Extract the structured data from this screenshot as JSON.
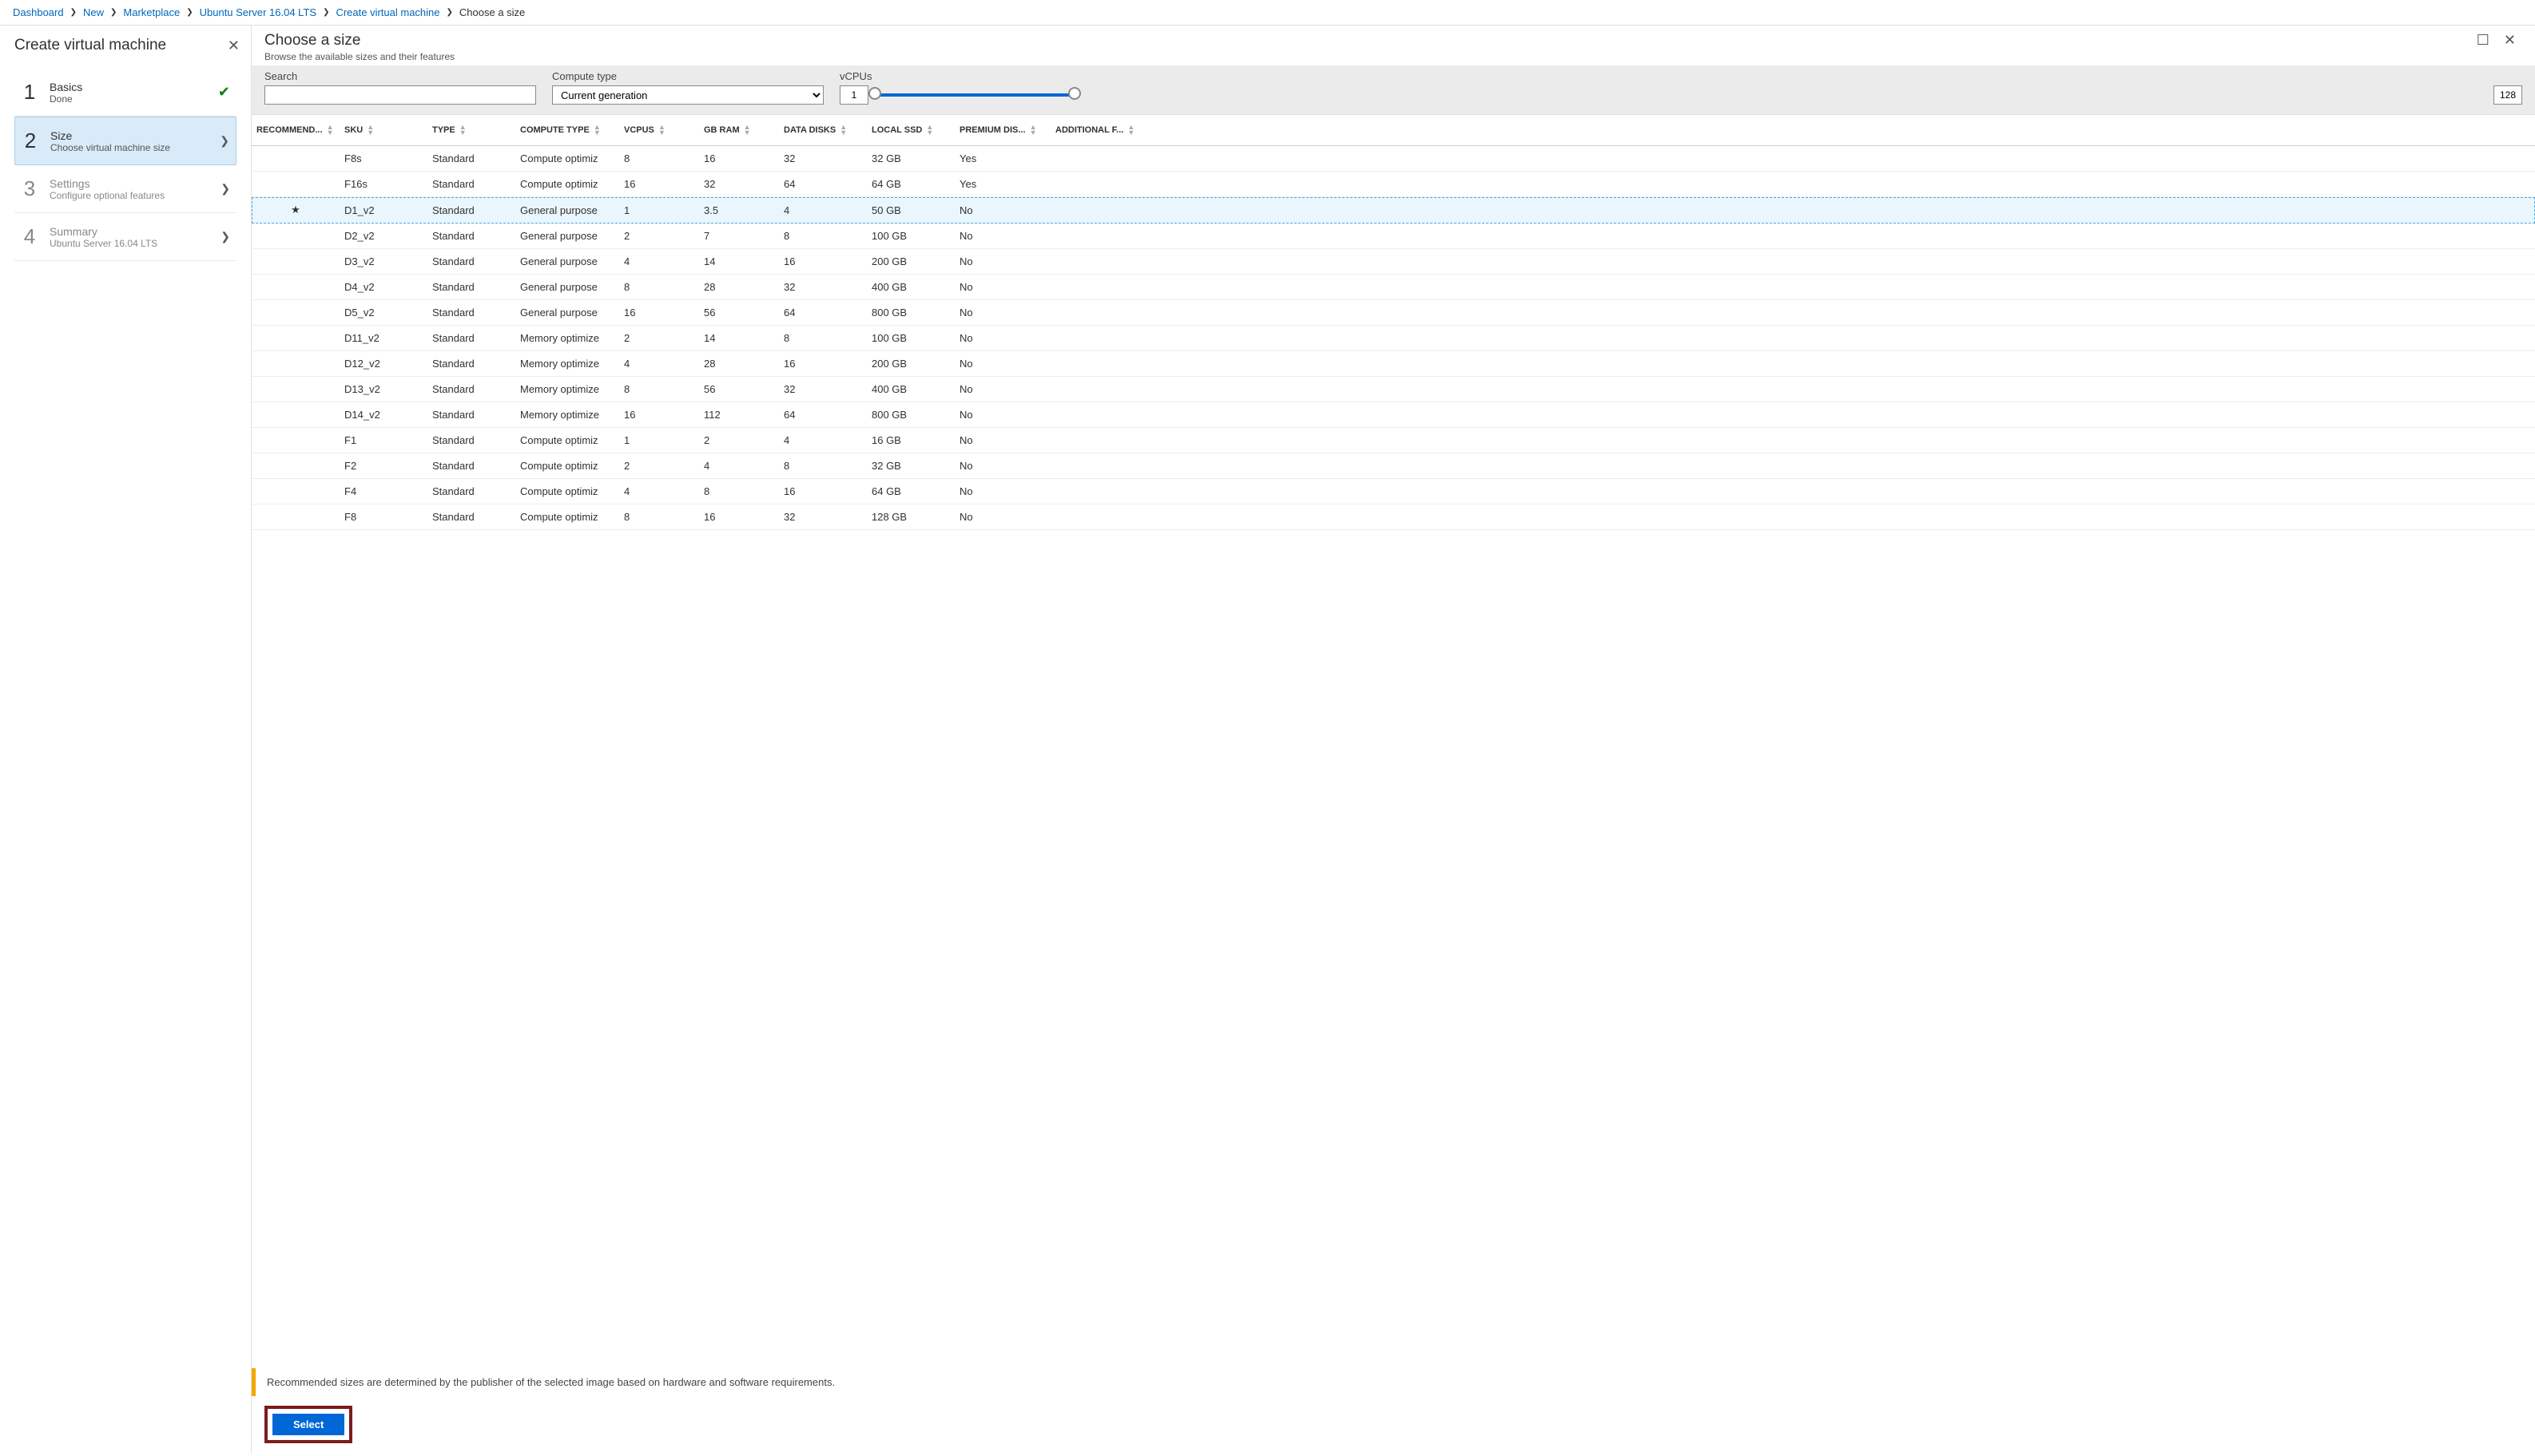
{
  "breadcrumb": {
    "items": [
      "Dashboard",
      "New",
      "Marketplace",
      "Ubuntu Server 16.04 LTS",
      "Create virtual machine"
    ],
    "current": "Choose a size"
  },
  "leftPanel": {
    "title": "Create virtual machine",
    "steps": [
      {
        "num": "1",
        "label": "Basics",
        "sub": "Done"
      },
      {
        "num": "2",
        "label": "Size",
        "sub": "Choose virtual machine size"
      },
      {
        "num": "3",
        "label": "Settings",
        "sub": "Configure optional features"
      },
      {
        "num": "4",
        "label": "Summary",
        "sub": "Ubuntu Server 16.04 LTS"
      }
    ]
  },
  "rightPanel": {
    "title": "Choose a size",
    "subtitle": "Browse the available sizes and their features"
  },
  "filters": {
    "searchLabel": "Search",
    "searchValue": "",
    "computeLabel": "Compute type",
    "computeValue": "Current generation",
    "vcpuLabel": "vCPUs",
    "vcpuMin": "1",
    "vcpuMax": "128"
  },
  "columns": [
    "RECOMMEND...",
    "SKU",
    "TYPE",
    "COMPUTE TYPE",
    "VCPUS",
    "GB RAM",
    "DATA DISKS",
    "LOCAL SSD",
    "PREMIUM DIS...",
    "ADDITIONAL F..."
  ],
  "rows": [
    {
      "rec": "",
      "sku": "F8s",
      "type": "Standard",
      "ctype": "Compute optimiz",
      "vcpus": "8",
      "ram": "16",
      "disks": "32",
      "ssd": "32 GB",
      "prem": "Yes",
      "add": ""
    },
    {
      "rec": "",
      "sku": "F16s",
      "type": "Standard",
      "ctype": "Compute optimiz",
      "vcpus": "16",
      "ram": "32",
      "disks": "64",
      "ssd": "64 GB",
      "prem": "Yes",
      "add": ""
    },
    {
      "rec": "★",
      "sku": "D1_v2",
      "type": "Standard",
      "ctype": "General purpose",
      "vcpus": "1",
      "ram": "3.5",
      "disks": "4",
      "ssd": "50 GB",
      "prem": "No",
      "add": "",
      "selected": true
    },
    {
      "rec": "",
      "sku": "D2_v2",
      "type": "Standard",
      "ctype": "General purpose",
      "vcpus": "2",
      "ram": "7",
      "disks": "8",
      "ssd": "100 GB",
      "prem": "No",
      "add": ""
    },
    {
      "rec": "",
      "sku": "D3_v2",
      "type": "Standard",
      "ctype": "General purpose",
      "vcpus": "4",
      "ram": "14",
      "disks": "16",
      "ssd": "200 GB",
      "prem": "No",
      "add": ""
    },
    {
      "rec": "",
      "sku": "D4_v2",
      "type": "Standard",
      "ctype": "General purpose",
      "vcpus": "8",
      "ram": "28",
      "disks": "32",
      "ssd": "400 GB",
      "prem": "No",
      "add": ""
    },
    {
      "rec": "",
      "sku": "D5_v2",
      "type": "Standard",
      "ctype": "General purpose",
      "vcpus": "16",
      "ram": "56",
      "disks": "64",
      "ssd": "800 GB",
      "prem": "No",
      "add": ""
    },
    {
      "rec": "",
      "sku": "D11_v2",
      "type": "Standard",
      "ctype": "Memory optimize",
      "vcpus": "2",
      "ram": "14",
      "disks": "8",
      "ssd": "100 GB",
      "prem": "No",
      "add": ""
    },
    {
      "rec": "",
      "sku": "D12_v2",
      "type": "Standard",
      "ctype": "Memory optimize",
      "vcpus": "4",
      "ram": "28",
      "disks": "16",
      "ssd": "200 GB",
      "prem": "No",
      "add": ""
    },
    {
      "rec": "",
      "sku": "D13_v2",
      "type": "Standard",
      "ctype": "Memory optimize",
      "vcpus": "8",
      "ram": "56",
      "disks": "32",
      "ssd": "400 GB",
      "prem": "No",
      "add": ""
    },
    {
      "rec": "",
      "sku": "D14_v2",
      "type": "Standard",
      "ctype": "Memory optimize",
      "vcpus": "16",
      "ram": "112",
      "disks": "64",
      "ssd": "800 GB",
      "prem": "No",
      "add": ""
    },
    {
      "rec": "",
      "sku": "F1",
      "type": "Standard",
      "ctype": "Compute optimiz",
      "vcpus": "1",
      "ram": "2",
      "disks": "4",
      "ssd": "16 GB",
      "prem": "No",
      "add": ""
    },
    {
      "rec": "",
      "sku": "F2",
      "type": "Standard",
      "ctype": "Compute optimiz",
      "vcpus": "2",
      "ram": "4",
      "disks": "8",
      "ssd": "32 GB",
      "prem": "No",
      "add": ""
    },
    {
      "rec": "",
      "sku": "F4",
      "type": "Standard",
      "ctype": "Compute optimiz",
      "vcpus": "4",
      "ram": "8",
      "disks": "16",
      "ssd": "64 GB",
      "prem": "No",
      "add": ""
    },
    {
      "rec": "",
      "sku": "F8",
      "type": "Standard",
      "ctype": "Compute optimiz",
      "vcpus": "8",
      "ram": "16",
      "disks": "32",
      "ssd": "128 GB",
      "prem": "No",
      "add": ""
    }
  ],
  "footer": {
    "note": "Recommended sizes are determined by the publisher of the selected image based on hardware and software requirements.",
    "selectLabel": "Select"
  }
}
